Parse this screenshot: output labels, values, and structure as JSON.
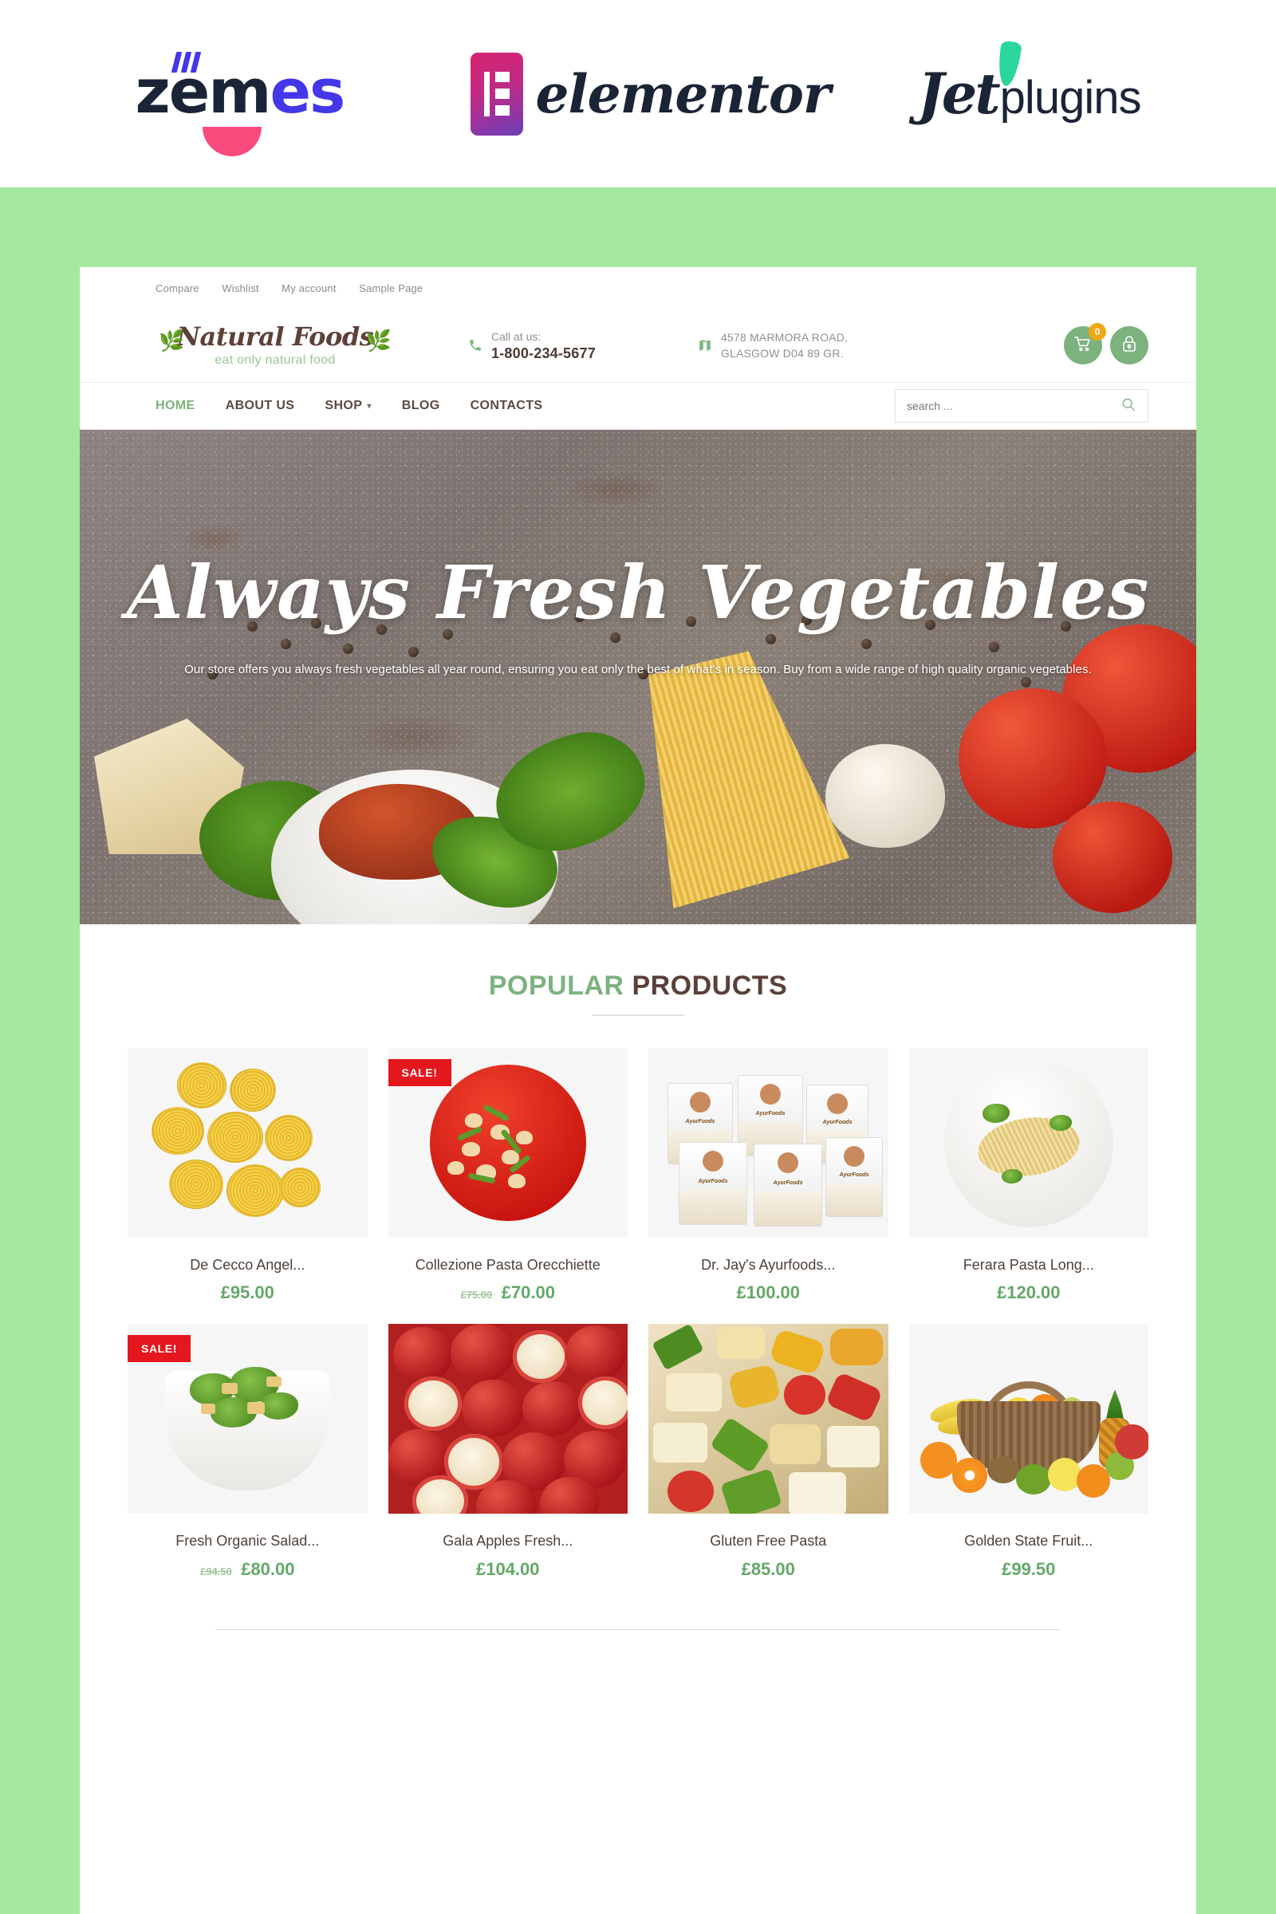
{
  "brandbar": {
    "zemez": {
      "part1": "z",
      "part2": "em",
      "part3": "es",
      "name": "zemes"
    },
    "elementor": {
      "name": "elementor"
    },
    "jetplugins": {
      "part1": "Jet",
      "part2": "plugins"
    }
  },
  "topbar": {
    "links": [
      {
        "label": "Compare"
      },
      {
        "label": "Wishlist"
      },
      {
        "label": "My account"
      },
      {
        "label": "Sample Page"
      }
    ]
  },
  "header": {
    "logo": {
      "title": "Natural Foods",
      "tagline": "eat only natural food"
    },
    "phone": {
      "label": "Call at us:",
      "number": "1-800-234-5677"
    },
    "address": {
      "line1": "4578 MARMORA ROAD,",
      "line2": "GLASGOW D04 89 GR."
    },
    "cart": {
      "count": "0"
    }
  },
  "nav": {
    "items": [
      {
        "label": "HOME",
        "active": true,
        "dropdown": false
      },
      {
        "label": "ABOUT US",
        "active": false,
        "dropdown": false
      },
      {
        "label": "SHOP",
        "active": false,
        "dropdown": true
      },
      {
        "label": "BLOG",
        "active": false,
        "dropdown": false
      },
      {
        "label": "CONTACTS",
        "active": false,
        "dropdown": false
      }
    ],
    "search": {
      "placeholder": "search ...",
      "value": ""
    }
  },
  "hero": {
    "title": "Always Fresh Vegetables",
    "subtitle": "Our store offers you always fresh vegetables all year round, ensuring you eat only the best of what's in season. Buy from a wide range of high quality organic vegetables."
  },
  "section": {
    "title_green": "POPULAR",
    "title_dark": "PRODUCTS"
  },
  "products": [
    {
      "name": "De Cecco Angel...",
      "price": "£95.00",
      "old_price": "",
      "sale": false
    },
    {
      "name": "Collezione Pasta Orecchiette",
      "price": "£70.00",
      "old_price": "£75.00",
      "sale": true
    },
    {
      "name": "Dr. Jay's Ayurfoods...",
      "price": "£100.00",
      "old_price": "",
      "sale": false
    },
    {
      "name": "Ferara Pasta Long...",
      "price": "£120.00",
      "old_price": "",
      "sale": false
    },
    {
      "name": "Fresh Organic Salad...",
      "price": "£80.00",
      "old_price": "£94.50",
      "sale": true
    },
    {
      "name": "Gala Apples Fresh...",
      "price": "£104.00",
      "old_price": "",
      "sale": false
    },
    {
      "name": "Gluten Free Pasta",
      "price": "£85.00",
      "old_price": "",
      "sale": false
    },
    {
      "name": "Golden State Fruit...",
      "price": "£99.50",
      "old_price": "",
      "sale": false
    }
  ],
  "badges": {
    "sale_label": "SALE!"
  },
  "colors": {
    "page_background": "#a5e8a0",
    "accent_green": "#7cb27e",
    "price_green": "#64a868",
    "dark_brown": "#5a4039",
    "sale_red": "#e4161e",
    "cart_badge_orange": "#f0a815"
  }
}
